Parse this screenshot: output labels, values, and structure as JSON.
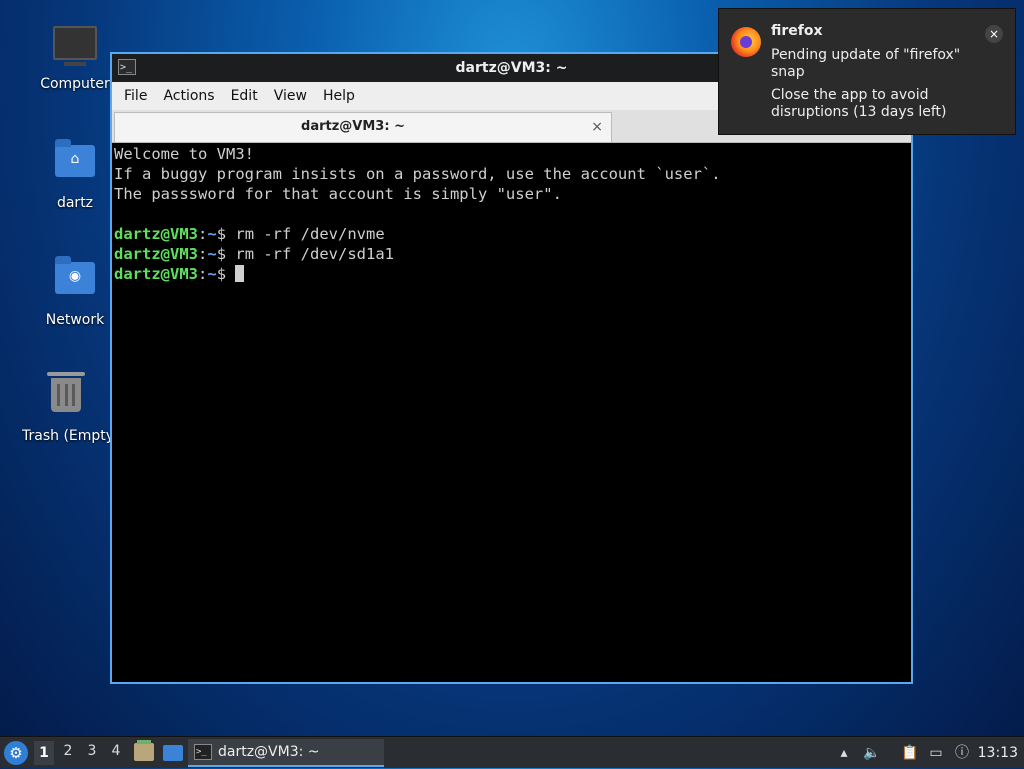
{
  "desktop": {
    "icons": [
      {
        "label": "Computer",
        "icon": "monitor-icon"
      },
      {
        "label": "dartz",
        "icon": "home-folder-icon"
      },
      {
        "label": "Network",
        "icon": "network-folder-icon"
      },
      {
        "label": "Trash (Empty)",
        "icon": "trash-icon"
      }
    ]
  },
  "window": {
    "title": "dartz@VM3: ~",
    "menu": [
      "File",
      "Actions",
      "Edit",
      "View",
      "Help"
    ],
    "tab": {
      "label": "dartz@VM3: ~",
      "close": "×"
    }
  },
  "terminal": {
    "motd": [
      "Welcome to VM3!",
      "If a buggy program insists on a password, use the account `user`.",
      "The passsword for that account is simply \"user\"."
    ],
    "prompt_user": "dartz@VM3",
    "prompt_sep": ":",
    "prompt_path": "~",
    "prompt_end": "$ ",
    "commands": [
      "rm -rf /dev/nvme",
      "rm -rf /dev/sd1a1",
      ""
    ]
  },
  "notification": {
    "app": "firefox",
    "summary": "Pending update of \"firefox\" snap",
    "body": "Close the app to avoid disruptions (13 days left)",
    "close": "×",
    "icon": "firefox-icon"
  },
  "taskbar": {
    "workspaces": [
      "1",
      "2",
      "3",
      "4"
    ],
    "active_workspace": "1",
    "task_label": "dartz@VM3: ~",
    "clock": "13:13"
  },
  "colors": {
    "window_border": "#5aa9f0",
    "prompt_user": "#5ee05e",
    "prompt_path": "#6aa0f0"
  }
}
